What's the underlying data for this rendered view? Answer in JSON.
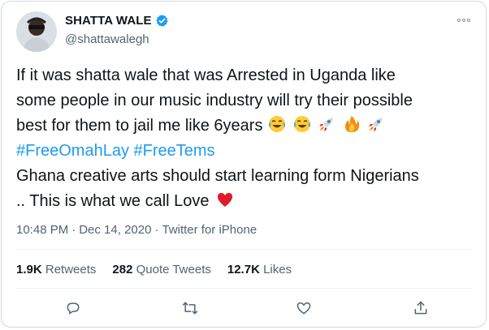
{
  "author": {
    "display_name": "SHATTA WALE",
    "handle": "@shattawalegh",
    "verified": true
  },
  "tweet": {
    "line1": "If it was shatta wale that was Arrested in Uganda like",
    "line2": "some people in our music industry will try their possible",
    "line3": "best  for them to jail me like 6years",
    "line3_emojis": [
      "tears-of-joy-emoji",
      "tears-of-joy-emoji",
      "rocket-emoji",
      "fire-emoji",
      "rocket-emoji"
    ],
    "hashtags": [
      "#FreeOmahLay",
      "#FreeTems"
    ],
    "line5": "Ghana creative arts should start learning  form Nigerians",
    "line6": ".. This is what we call Love",
    "line6_emoji": "red-heart-emoji"
  },
  "meta": {
    "time": "10:48 PM",
    "date": "Dec 14, 2020",
    "dot": "·",
    "source": "Twitter for iPhone"
  },
  "stats": {
    "retweets_count": "1.9K",
    "retweets_label": "Retweets",
    "quotes_count": "282",
    "quotes_label": "Quote Tweets",
    "likes_count": "12.7K",
    "likes_label": "Likes"
  },
  "colors": {
    "hashtag": "#1d9bf0",
    "verified": "#1d9bf0",
    "secondary_text": "#536471",
    "icon": "#536471"
  },
  "icons": [
    "verified-badge-icon",
    "more-icon",
    "reply-icon",
    "retweet-icon",
    "like-icon",
    "share-icon"
  ]
}
